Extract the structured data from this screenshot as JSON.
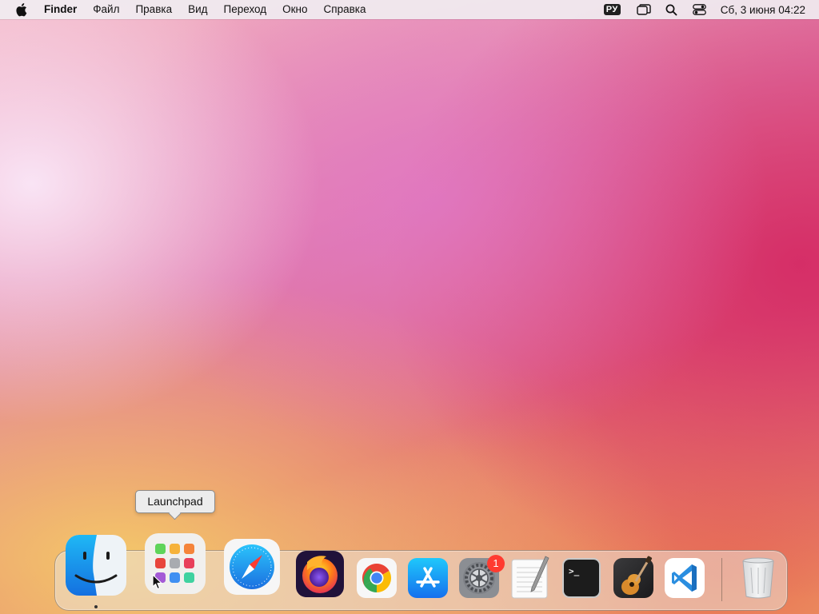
{
  "menubar": {
    "app_name": "Finder",
    "menus": [
      "Файл",
      "Правка",
      "Вид",
      "Переход",
      "Окно",
      "Справка"
    ],
    "input_language": "РУ",
    "clock": "Сб, 3 июня  04:22"
  },
  "tooltip": {
    "text": "Launchpad"
  },
  "dock": {
    "apps": [
      {
        "name": "Finder",
        "icon": "finder-icon",
        "running": true
      },
      {
        "name": "Launchpad",
        "icon": "launchpad-icon",
        "hovered": true
      },
      {
        "name": "Safari",
        "icon": "safari-icon"
      },
      {
        "name": "Firefox",
        "icon": "firefox-icon"
      },
      {
        "name": "Google Chrome",
        "icon": "chrome-icon"
      },
      {
        "name": "App Store",
        "icon": "app-store-icon"
      },
      {
        "name": "System Preferences",
        "icon": "system-preferences-icon",
        "badge": "1"
      },
      {
        "name": "TextEdit",
        "icon": "textedit-icon"
      },
      {
        "name": "Terminal",
        "icon": "terminal-icon"
      },
      {
        "name": "GarageBand",
        "icon": "garageband-icon"
      },
      {
        "name": "Visual Studio Code",
        "icon": "vscode-icon"
      },
      {
        "name": "Trash",
        "icon": "trash-icon"
      }
    ],
    "badge_count": "1"
  }
}
